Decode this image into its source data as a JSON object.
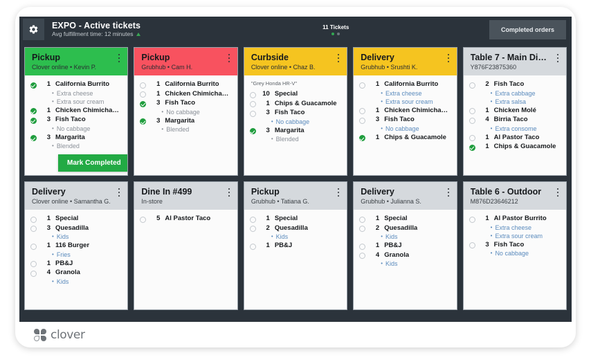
{
  "header": {
    "gear_icon": "gear-icon",
    "title": "EXPO - Active tickets",
    "subtitle": "Avg fulfillment time: 12 minutes",
    "trend_icon": "up-arrow-icon",
    "ticket_count": "11 Tickets",
    "completed_orders_label": "Completed orders"
  },
  "footer": {
    "brand": "clover",
    "brand_icon": "clover-logo-icon"
  },
  "colors": {
    "green": "#2dbe4e",
    "red": "#f8525f",
    "yellow": "#f5c420",
    "grey": "#d5d9dd",
    "dark_bar": "#2b333b",
    "check_done": "#1f9d3d",
    "mod_blue": "#5b8bbd",
    "mod_grey": "#8b9199",
    "mark_completed_bg": "#22aa44"
  },
  "tickets": [
    {
      "title": "Pickup",
      "subtitle": "Clover online •  Kevin P.",
      "header_color": "green",
      "note": "",
      "has_mark_completed": true,
      "mark_completed_label": "Mark Completed",
      "items": [
        {
          "done": true,
          "qty": "1",
          "name": "California Burrito",
          "mods": [
            {
              "text": "Extra cheese",
              "style": "grey"
            },
            {
              "text": "Extra sour cream",
              "style": "grey"
            }
          ]
        },
        {
          "done": true,
          "qty": "1",
          "name": "Chicken Chimichanga",
          "mods": []
        },
        {
          "done": true,
          "qty": "3",
          "name": "Fish Taco",
          "mods": [
            {
              "text": "No cabbage",
              "style": "grey"
            }
          ]
        },
        {
          "done": true,
          "qty": "3",
          "name": "Margarita",
          "mods": [
            {
              "text": "Blended",
              "style": "grey"
            }
          ]
        }
      ]
    },
    {
      "title": "Pickup",
      "subtitle": "Grubhub •  Cam H.",
      "header_color": "red",
      "note": "",
      "has_mark_completed": false,
      "items": [
        {
          "done": false,
          "qty": "1",
          "name": "California Burrito",
          "mods": []
        },
        {
          "done": false,
          "qty": "1",
          "name": "Chicken Chimichanga",
          "mods": []
        },
        {
          "done": true,
          "qty": "3",
          "name": "Fish Taco",
          "mods": [
            {
              "text": "No cabbage",
              "style": "grey"
            }
          ]
        },
        {
          "done": true,
          "qty": "3",
          "name": "Margarita",
          "mods": [
            {
              "text": "Blended",
              "style": "grey"
            }
          ]
        }
      ]
    },
    {
      "title": "Curbside",
      "subtitle": "Clover online •  Chaz B.",
      "header_color": "yellow",
      "note": "\"Grey Honda HR-V\"",
      "has_mark_completed": false,
      "items": [
        {
          "done": false,
          "qty": "10",
          "name": "Special",
          "mods": []
        },
        {
          "done": false,
          "qty": "1",
          "name": "Chips & Guacamole",
          "mods": []
        },
        {
          "done": false,
          "qty": "3",
          "name": "Fish Taco",
          "mods": [
            {
              "text": "No cabbage",
              "style": "blue"
            }
          ]
        },
        {
          "done": true,
          "qty": "3",
          "name": "Margarita",
          "mods": [
            {
              "text": "Blended",
              "style": "grey"
            }
          ]
        }
      ]
    },
    {
      "title": "Delivery",
      "subtitle": "Grubhub •  Srushti K.",
      "header_color": "yellow",
      "note": "",
      "has_mark_completed": false,
      "items": [
        {
          "done": false,
          "qty": "1",
          "name": "California Burrito",
          "mods": [
            {
              "text": "Extra cheese",
              "style": "blue"
            },
            {
              "text": "Extra sour cream",
              "style": "blue"
            }
          ]
        },
        {
          "done": false,
          "qty": "1",
          "name": "Chicken Chimichanga",
          "mods": []
        },
        {
          "done": false,
          "qty": "3",
          "name": "Fish Taco",
          "mods": [
            {
              "text": "No cabbage",
              "style": "blue"
            }
          ]
        },
        {
          "done": true,
          "qty": "1",
          "name": "Chips & Guacamole",
          "mods": []
        }
      ]
    },
    {
      "title": "Table 7 - Main Din...",
      "subtitle": "Y876F23875360",
      "header_color": "grey",
      "note": "",
      "has_mark_completed": false,
      "items": [
        {
          "done": false,
          "qty": "2",
          "name": "Fish Taco",
          "mods": [
            {
              "text": "Extra cabbage",
              "style": "blue"
            },
            {
              "text": "Extra salsa",
              "style": "blue"
            }
          ]
        },
        {
          "done": false,
          "qty": "1",
          "name": "Chicken Molé",
          "mods": []
        },
        {
          "done": false,
          "qty": "4",
          "name": "Birria Taco",
          "mods": [
            {
              "text": "Extra consome",
              "style": "blue"
            }
          ]
        },
        {
          "done": false,
          "qty": "1",
          "name": "Al Pastor Taco",
          "mods": []
        },
        {
          "done": true,
          "qty": "1",
          "name": "Chips & Guacamole",
          "mods": []
        }
      ]
    },
    {
      "title": "Delivery",
      "subtitle": "Clover online • Samantha G.",
      "header_color": "grey",
      "note": "",
      "has_mark_completed": false,
      "items": [
        {
          "done": false,
          "qty": "1",
          "name": "Special",
          "mods": []
        },
        {
          "done": false,
          "qty": "3",
          "name": "Quesadilla",
          "mods": [
            {
              "text": "Kids",
              "style": "blue"
            }
          ]
        },
        {
          "done": false,
          "qty": "1",
          "name": "116 Burger",
          "mods": [
            {
              "text": "Fries",
              "style": "blue"
            }
          ]
        },
        {
          "done": false,
          "qty": "1",
          "name": "PB&J",
          "mods": []
        },
        {
          "done": false,
          "qty": "4",
          "name": "Granola",
          "mods": [
            {
              "text": "Kids",
              "style": "blue"
            }
          ]
        }
      ]
    },
    {
      "title": "Dine In #499",
      "subtitle": "In-store",
      "header_color": "grey",
      "note": "",
      "has_mark_completed": false,
      "items": [
        {
          "done": false,
          "qty": "5",
          "name": "Al Pastor Taco",
          "mods": []
        }
      ]
    },
    {
      "title": "Pickup",
      "subtitle": "Grubhub •  Tatiana G.",
      "header_color": "grey",
      "note": "",
      "has_mark_completed": false,
      "items": [
        {
          "done": false,
          "qty": "1",
          "name": "Special",
          "mods": []
        },
        {
          "done": false,
          "qty": "2",
          "name": "Quesadilla",
          "mods": [
            {
              "text": "Kids",
              "style": "blue"
            }
          ]
        },
        {
          "done": false,
          "qty": "1",
          "name": "PB&J",
          "mods": []
        }
      ]
    },
    {
      "title": "Delivery",
      "subtitle": "Grubhub •  Julianna S.",
      "header_color": "grey",
      "note": "",
      "has_mark_completed": false,
      "items": [
        {
          "done": false,
          "qty": "1",
          "name": "Special",
          "mods": []
        },
        {
          "done": false,
          "qty": "2",
          "name": "Quesadilla",
          "mods": [
            {
              "text": "Kids",
              "style": "blue"
            }
          ]
        },
        {
          "done": false,
          "qty": "1",
          "name": "PB&J",
          "mods": []
        },
        {
          "done": false,
          "qty": "4",
          "name": "Granola",
          "mods": [
            {
              "text": "Kids",
              "style": "blue"
            }
          ]
        }
      ]
    },
    {
      "title": "Table 6 - Outdoor",
      "subtitle": "M876D23646212",
      "header_color": "grey",
      "note": "",
      "has_mark_completed": false,
      "items": [
        {
          "done": false,
          "qty": "1",
          "name": "Al Pastor Burrito",
          "mods": [
            {
              "text": "Extra cheese",
              "style": "blue"
            },
            {
              "text": "Extra sour cream",
              "style": "blue"
            }
          ]
        },
        {
          "done": false,
          "qty": "3",
          "name": "Fish Taco",
          "mods": [
            {
              "text": "No cabbage",
              "style": "blue"
            }
          ]
        }
      ]
    }
  ]
}
